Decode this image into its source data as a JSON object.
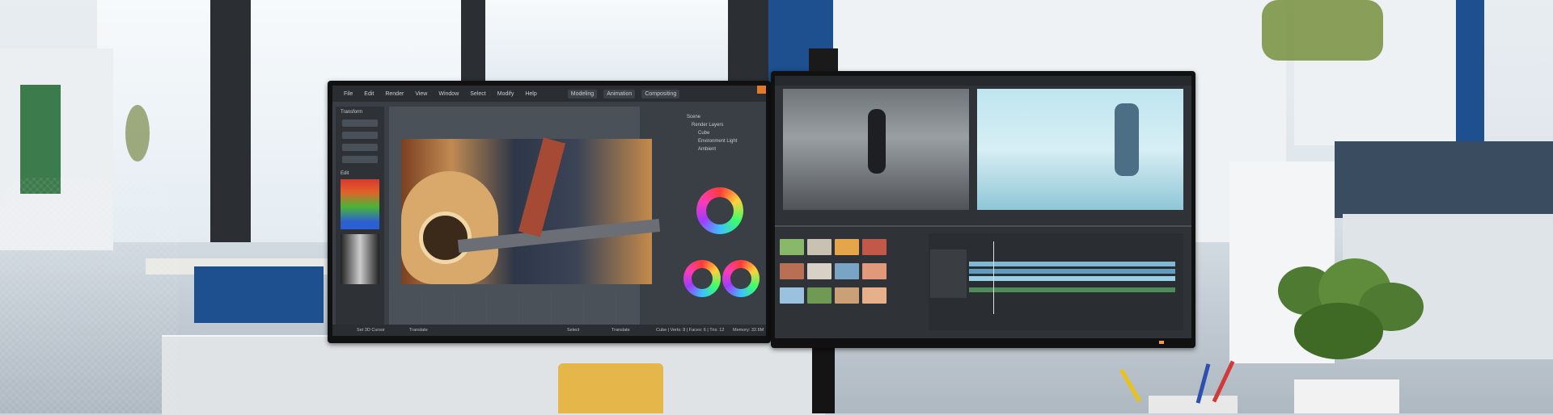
{
  "left_monitor": {
    "menu": [
      "File",
      "Edit",
      "Render",
      "View",
      "Window",
      "Select",
      "Modify",
      "Help"
    ],
    "workspace_tabs": [
      "Modeling",
      "Animation",
      "Compositing"
    ],
    "sidebar": {
      "transform_title": "Transform",
      "edit_title": "Edit"
    },
    "scene_panel": {
      "title": "Scene",
      "items": [
        "Render Layers",
        "Cube",
        "Environment Light",
        "Ambient"
      ]
    },
    "status_bar": {
      "left_1": "Set 3D Cursor",
      "left_2": "Translate",
      "mid_1": "Select",
      "mid_2": "Translate",
      "right": "Cube | Verts: 8 | Faces: 6 | Tris: 12",
      "memory": "Memory: 32.6M"
    }
  },
  "colors": {
    "accent_orange": "#e07a2c",
    "ring_gradient": [
      "#ff3b3b",
      "#ffd23b",
      "#3bff6a",
      "#3bbfff",
      "#a03bff",
      "#ff3bb5"
    ]
  }
}
